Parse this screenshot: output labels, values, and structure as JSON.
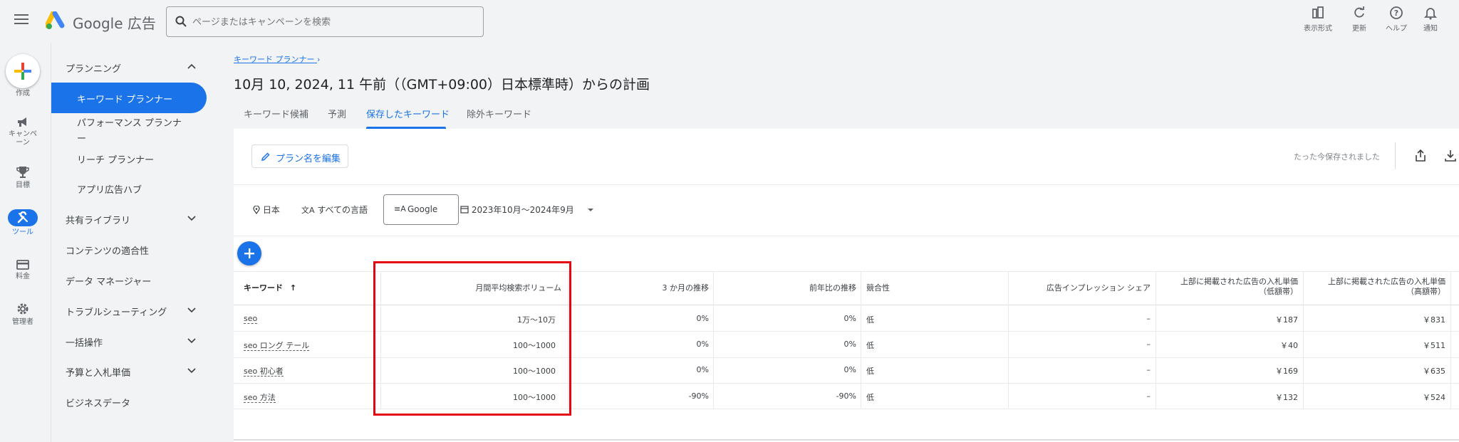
{
  "app": {
    "brand": "Google 広告"
  },
  "search": {
    "placeholder": "ページまたはキャンペーンを検索"
  },
  "toolbar": [
    {
      "label": "表示形式",
      "icon": "appearance-icon"
    },
    {
      "label": "更新",
      "icon": "refresh-icon"
    },
    {
      "label": "ヘルプ",
      "icon": "help-icon"
    },
    {
      "label": "通知",
      "icon": "bell-icon"
    }
  ],
  "rail": {
    "create": "作成",
    "campaign": "キャンペーン",
    "goals": "目標",
    "tools": "ツール",
    "billing": "料金",
    "admin": "管理者"
  },
  "nav": {
    "planning": "プランニング",
    "keyword_planner": "キーワード プランナー",
    "performance_planner_1": "パフォーマンス プランナ",
    "performance_planner_2": "ー",
    "reach_planner": "リーチ プランナー",
    "app_hub": "アプリ広告ハブ",
    "shared_library": "共有ライブラリ",
    "content_suitability": "コンテンツの適合性",
    "data_manager": "データ マネージャー",
    "troubleshooting": "トラブルシューティング",
    "bulk_actions": "一括操作",
    "budgets_bids": "予算と入札単価",
    "business_data": "ビジネスデータ"
  },
  "page": {
    "breadcrumb": "キーワード プランナー",
    "title": "10月 10, 2024, 11 午前（（GMT+09:00）日本標準時）からの計画",
    "tabs": [
      "キーワード候補",
      "予測",
      "保存したキーワード",
      "除外キーワード"
    ],
    "edit_plan": "プラン名を編集",
    "saved_status": "たった今保存されました"
  },
  "filters": {
    "location": "日本",
    "language": "すべての言語",
    "network": "Google",
    "date_range": "2023年10月～2024年9月"
  },
  "table": {
    "headers": {
      "keyword": "キーワード",
      "avg_monthly": "月間平均検索ボリューム",
      "three_month": "3 か月の推移",
      "yoy": "前年比の推移",
      "competition": "競合性",
      "impression_share": "広告インプレッション シェア",
      "bid_low_1": "上部に掲載された広告の入札単価",
      "bid_low_2": "（低額帯）",
      "bid_high_1": "上部に掲載された広告の入札単価",
      "bid_high_2": "（高額帯）"
    },
    "rows": [
      {
        "keyword": "seo",
        "avg": "1万～10万",
        "three_month": "0%",
        "yoy": "0%",
        "competition": "低",
        "share": "–",
        "bid_low": "￥187",
        "bid_high": "￥831"
      },
      {
        "keyword": "seo ロング テール",
        "avg": "100～1000",
        "three_month": "0%",
        "yoy": "0%",
        "competition": "低",
        "share": "–",
        "bid_low": "￥40",
        "bid_high": "￥511"
      },
      {
        "keyword": "seo 初心者",
        "avg": "100～1000",
        "three_month": "0%",
        "yoy": "0%",
        "competition": "低",
        "share": "–",
        "bid_low": "￥169",
        "bid_high": "￥635"
      },
      {
        "keyword": "seo 方法",
        "avg": "100～1000",
        "three_month": "-90%",
        "yoy": "-90%",
        "competition": "低",
        "share": "–",
        "bid_low": "￥132",
        "bid_high": "￥524"
      }
    ]
  },
  "colors": {
    "accent": "#1a73e8",
    "highlight": "#e30613"
  }
}
